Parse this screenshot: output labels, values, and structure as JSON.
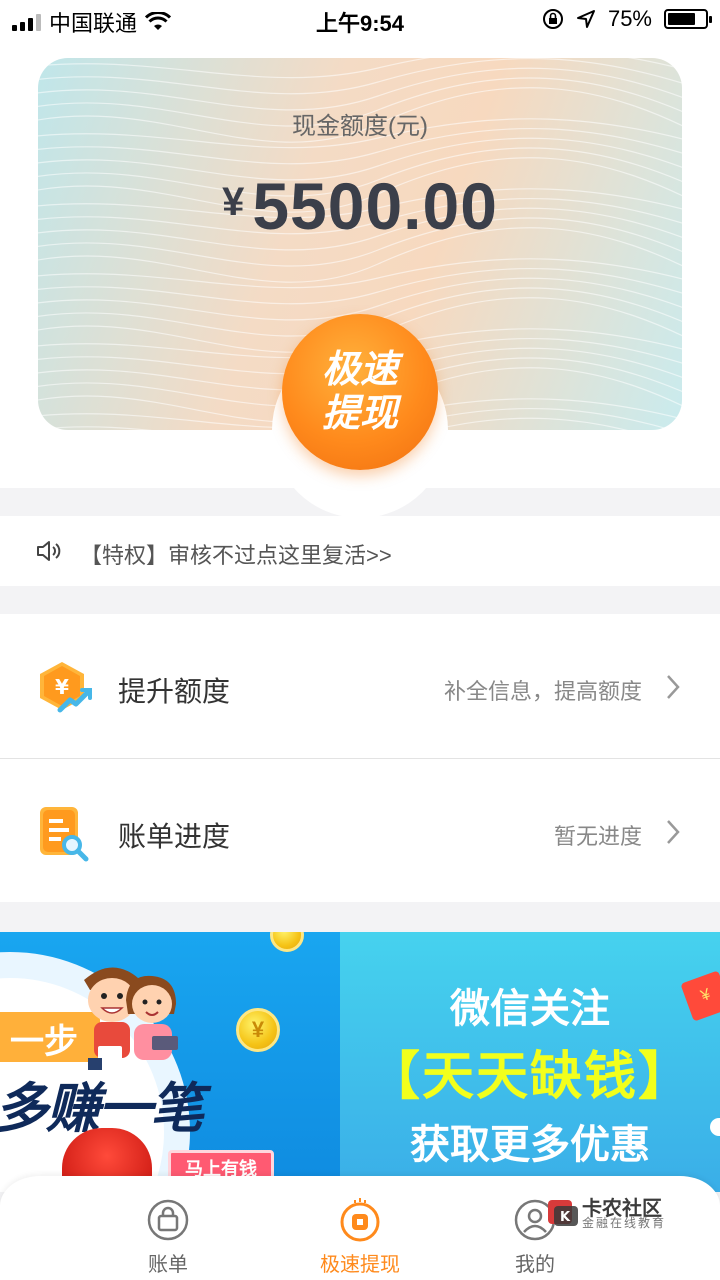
{
  "status_bar": {
    "carrier": "中国联通",
    "time": "上午9:54",
    "battery_text": "75%",
    "battery_level": 0.75
  },
  "credit_card": {
    "label": "现金额度(元)",
    "currency_symbol": "¥",
    "amount": "5500.00",
    "cash_button_line1": "极速",
    "cash_button_line2": "提现"
  },
  "notice": {
    "text": "【特权】审核不过点这里复活>>"
  },
  "menu": [
    {
      "title": "提升额度",
      "hint": "补全信息，提高额度",
      "icon": "raise-limit-icon"
    },
    {
      "title": "账单进度",
      "hint": "暂无进度",
      "icon": "bill-progress-icon"
    }
  ],
  "banner": {
    "left_bubble": "一步",
    "left_slogan": "多赚一笔",
    "coin_symbol": "¥",
    "ticket_text": "马上有钱",
    "right_line1": "微信关注",
    "right_line2": "【天天缺钱】",
    "right_line3": "获取更多优惠",
    "red_packet": "¥"
  },
  "tabbar": {
    "tabs": [
      {
        "label": "账单",
        "icon": "bag-icon",
        "active": false
      },
      {
        "label": "极速提现",
        "icon": "cash-coin-icon",
        "active": true
      },
      {
        "label": "我的",
        "icon": "profile-icon",
        "active": false
      }
    ]
  },
  "watermark": {
    "title": "卡农社区",
    "subtitle": "金融在线教育"
  },
  "colors": {
    "accent": "#ff8a1c",
    "banner_left": "#19a6f0",
    "banner_right": "#46d2ee",
    "highlight_yellow": "#f2ff1c"
  }
}
